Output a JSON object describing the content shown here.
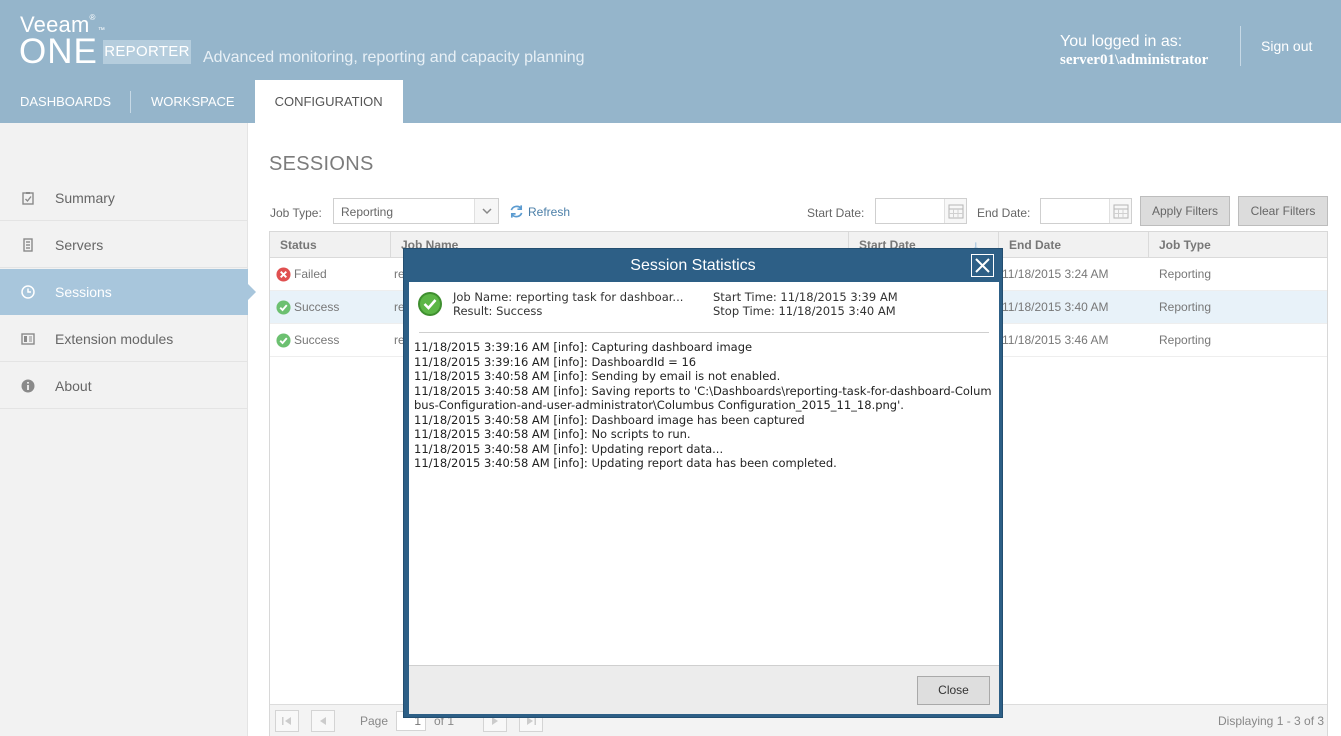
{
  "header": {
    "logo_veeam": "Veeam",
    "logo_veeam_mark": "®",
    "logo_one": "ONE",
    "logo_one_mark": "™",
    "logo_reporter": "REPORTER",
    "tagline": "Advanced monitoring, reporting and capacity planning",
    "login_label": "You logged in as:",
    "login_user": "server01\\administrator",
    "signout": "Sign out"
  },
  "nav": {
    "tabs": [
      {
        "label": "DASHBOARDS"
      },
      {
        "label": "WORKSPACE"
      },
      {
        "label": "CONFIGURATION",
        "active": true
      }
    ]
  },
  "sidebar": {
    "items": [
      {
        "label": "Summary",
        "icon": "clipboard-check-icon"
      },
      {
        "label": "Servers",
        "icon": "server-icon"
      },
      {
        "label": "Sessions",
        "icon": "clock-icon",
        "active": true
      },
      {
        "label": "Extension modules",
        "icon": "module-icon"
      },
      {
        "label": "About",
        "icon": "info-icon"
      }
    ]
  },
  "main": {
    "title": "SESSIONS",
    "job_type_label": "Job Type:",
    "job_type_value": "Reporting",
    "refresh": "Refresh",
    "start_date_label": "Start Date:",
    "start_date_value": "",
    "end_date_label": "End Date:",
    "end_date_value": "",
    "apply_filters": "Apply Filters",
    "clear_filters": "Clear Filters"
  },
  "grid": {
    "columns": [
      "Status",
      "Job Name",
      "Start Date",
      "End Date",
      "Job Type"
    ],
    "sort_indicator": "↓",
    "rows": [
      {
        "status": "Failed",
        "status_icon": "error-icon",
        "job_name_partial": "re",
        "end_date_partial": "11/18/2015 3:24 AM",
        "job_type": "Reporting"
      },
      {
        "status": "Success",
        "status_icon": "success-icon",
        "job_name_partial": "re",
        "end_date_partial": "11/18/2015 3:40 AM",
        "job_type": "Reporting",
        "selected": true
      },
      {
        "status": "Success",
        "status_icon": "success-icon",
        "job_name_partial": "re",
        "end_date_partial": "11/18/2015 3:46 AM",
        "job_type": "Reporting"
      }
    ],
    "pager": {
      "page_label": "Page",
      "page_value": "1",
      "of_label": "of 1",
      "displaying": "Displaying 1 - 3 of 3"
    }
  },
  "modal": {
    "title": "Session Statistics",
    "job_name": "Job Name: reporting task for dashboar...",
    "result": "Result: Success",
    "start_time": "Start Time: 11/18/2015 3:39 AM",
    "stop_time": "Stop Time: 11/18/2015 3:40 AM",
    "log": [
      "11/18/2015 3:39:16 AM [info]: Capturing dashboard image",
      "11/18/2015 3:39:16 AM [info]: DashboardId = 16",
      "11/18/2015 3:40:58 AM [info]: Sending by email is not enabled.",
      "11/18/2015 3:40:58 AM [info]: Saving reports to 'C:\\Dashboards\\reporting-task-for-dashboard-Columbus-Configuration-and-user-administrator\\Columbus Configuration_2015_11_18.png'.",
      "11/18/2015 3:40:58 AM [info]: Dashboard image has been captured",
      "11/18/2015 3:40:58 AM [info]: No scripts to run.",
      "11/18/2015 3:40:58 AM [info]: Updating report data...",
      "11/18/2015 3:40:58 AM [info]: Updating report data has been completed."
    ],
    "close_label": "Close"
  },
  "colors": {
    "header_bg": "#95b5cb",
    "active_side": "#a8c6dc",
    "modal_frame": "#2d5f86",
    "success": "#5cb85c",
    "failed": "#e05050"
  }
}
